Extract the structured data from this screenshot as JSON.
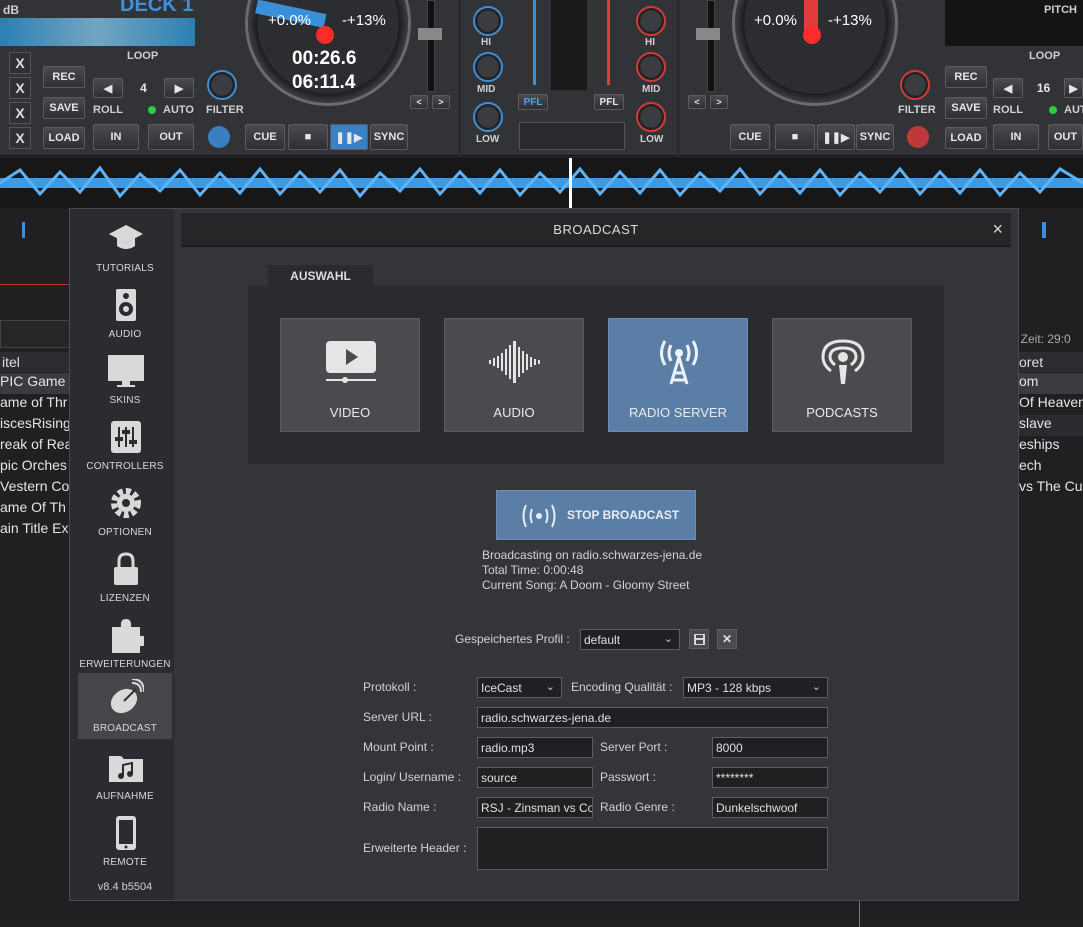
{
  "deck_left": {
    "db_label": "dB",
    "deck_title": "DECK 1",
    "loop_label": "LOOP",
    "loop_value": "4",
    "rec": "REC",
    "save": "SAVE",
    "load": "LOAD",
    "roll": "ROLL",
    "auto": "AUTO",
    "in": "IN",
    "out": "OUT",
    "filter": "FILTER",
    "cue": "CUE",
    "sync": "SYNC",
    "pitch_current": "+0.0%",
    "pitch_range": "-+13%",
    "time_elapsed": "00:26.6",
    "time_remaining": "06:11.4",
    "x_buttons": [
      "X",
      "X",
      "X",
      "X"
    ]
  },
  "mixer": {
    "hi": "HI",
    "mid": "MID",
    "low": "LOW",
    "pfl": "PFL"
  },
  "deck_right": {
    "pitch_label": "PITCH",
    "loop_label": "LOOP",
    "loop_value": "16",
    "rec": "REC",
    "save": "SAVE",
    "load": "LOAD",
    "roll": "ROLL",
    "auto": "AUTO",
    "in": "IN",
    "out": "OUT",
    "filter": "FILTER",
    "cue": "CUE",
    "sync": "SYNC",
    "pitch_current": "+0.0%",
    "pitch_range": "-+13%"
  },
  "browser_bg": {
    "left_header": "itel",
    "left_rows": [
      "PIC Game",
      "ame of Thr",
      "iscesRising",
      "reak of Rea",
      "pic Orches",
      "Vestern Co",
      "ame Of Th",
      "ain Title Ex"
    ],
    "right_header": "oret",
    "right_rows": [
      "om",
      "Of Heaven",
      "slave",
      "eships",
      "ech",
      "vs The Cure"
    ],
    "zeit": "t Zeit: 29:0"
  },
  "dialog": {
    "title": "BROADCAST",
    "close": "×",
    "sidebar": [
      {
        "label": "TUTORIALS"
      },
      {
        "label": "AUDIO"
      },
      {
        "label": "SKINS"
      },
      {
        "label": "CONTROLLERS"
      },
      {
        "label": "OPTIONEN"
      },
      {
        "label": "LIZENZEN"
      },
      {
        "label": "ERWEITERUNGEN"
      },
      {
        "label": "BROADCAST"
      },
      {
        "label": "AUFNAHME"
      },
      {
        "label": "REMOTE"
      }
    ],
    "version": "v8.4 b5504",
    "auswahl_tab": "AUSWAHL",
    "choices": [
      {
        "label": "VIDEO"
      },
      {
        "label": "AUDIO"
      },
      {
        "label": "RADIO SERVER"
      },
      {
        "label": "PODCASTS"
      }
    ],
    "stop_button": "STOP BROADCAST",
    "info": {
      "line1": "Broadcasting on radio.schwarzes-jena.de",
      "line2": "Total Time: 0:00:48",
      "line3": "Current Song: A Doom - Gloomy Street"
    },
    "profile": {
      "label": "Gespeichertes Profil :",
      "value": "default"
    },
    "form": {
      "protokoll_label": "Protokoll :",
      "protokoll_value": "IceCast",
      "encoding_label": "Encoding Qualität :",
      "encoding_value": "MP3 - 128 kbps",
      "server_url_label": "Server URL :",
      "server_url_value": "radio.schwarzes-jena.de",
      "mount_label": "Mount Point :",
      "mount_value": "radio.mp3",
      "port_label": "Server Port :",
      "port_value": "8000",
      "login_label": "Login/ Username :",
      "login_value": "source",
      "password_label": "Passwort :",
      "password_value": "********",
      "radio_name_label": "Radio Name :",
      "radio_name_value": "RSJ - Zinsman vs Cold",
      "genre_label": "Radio Genre :",
      "genre_value": "Dunkelschwoof",
      "header_label": "Erweiterte Header :",
      "header_value": ""
    }
  }
}
